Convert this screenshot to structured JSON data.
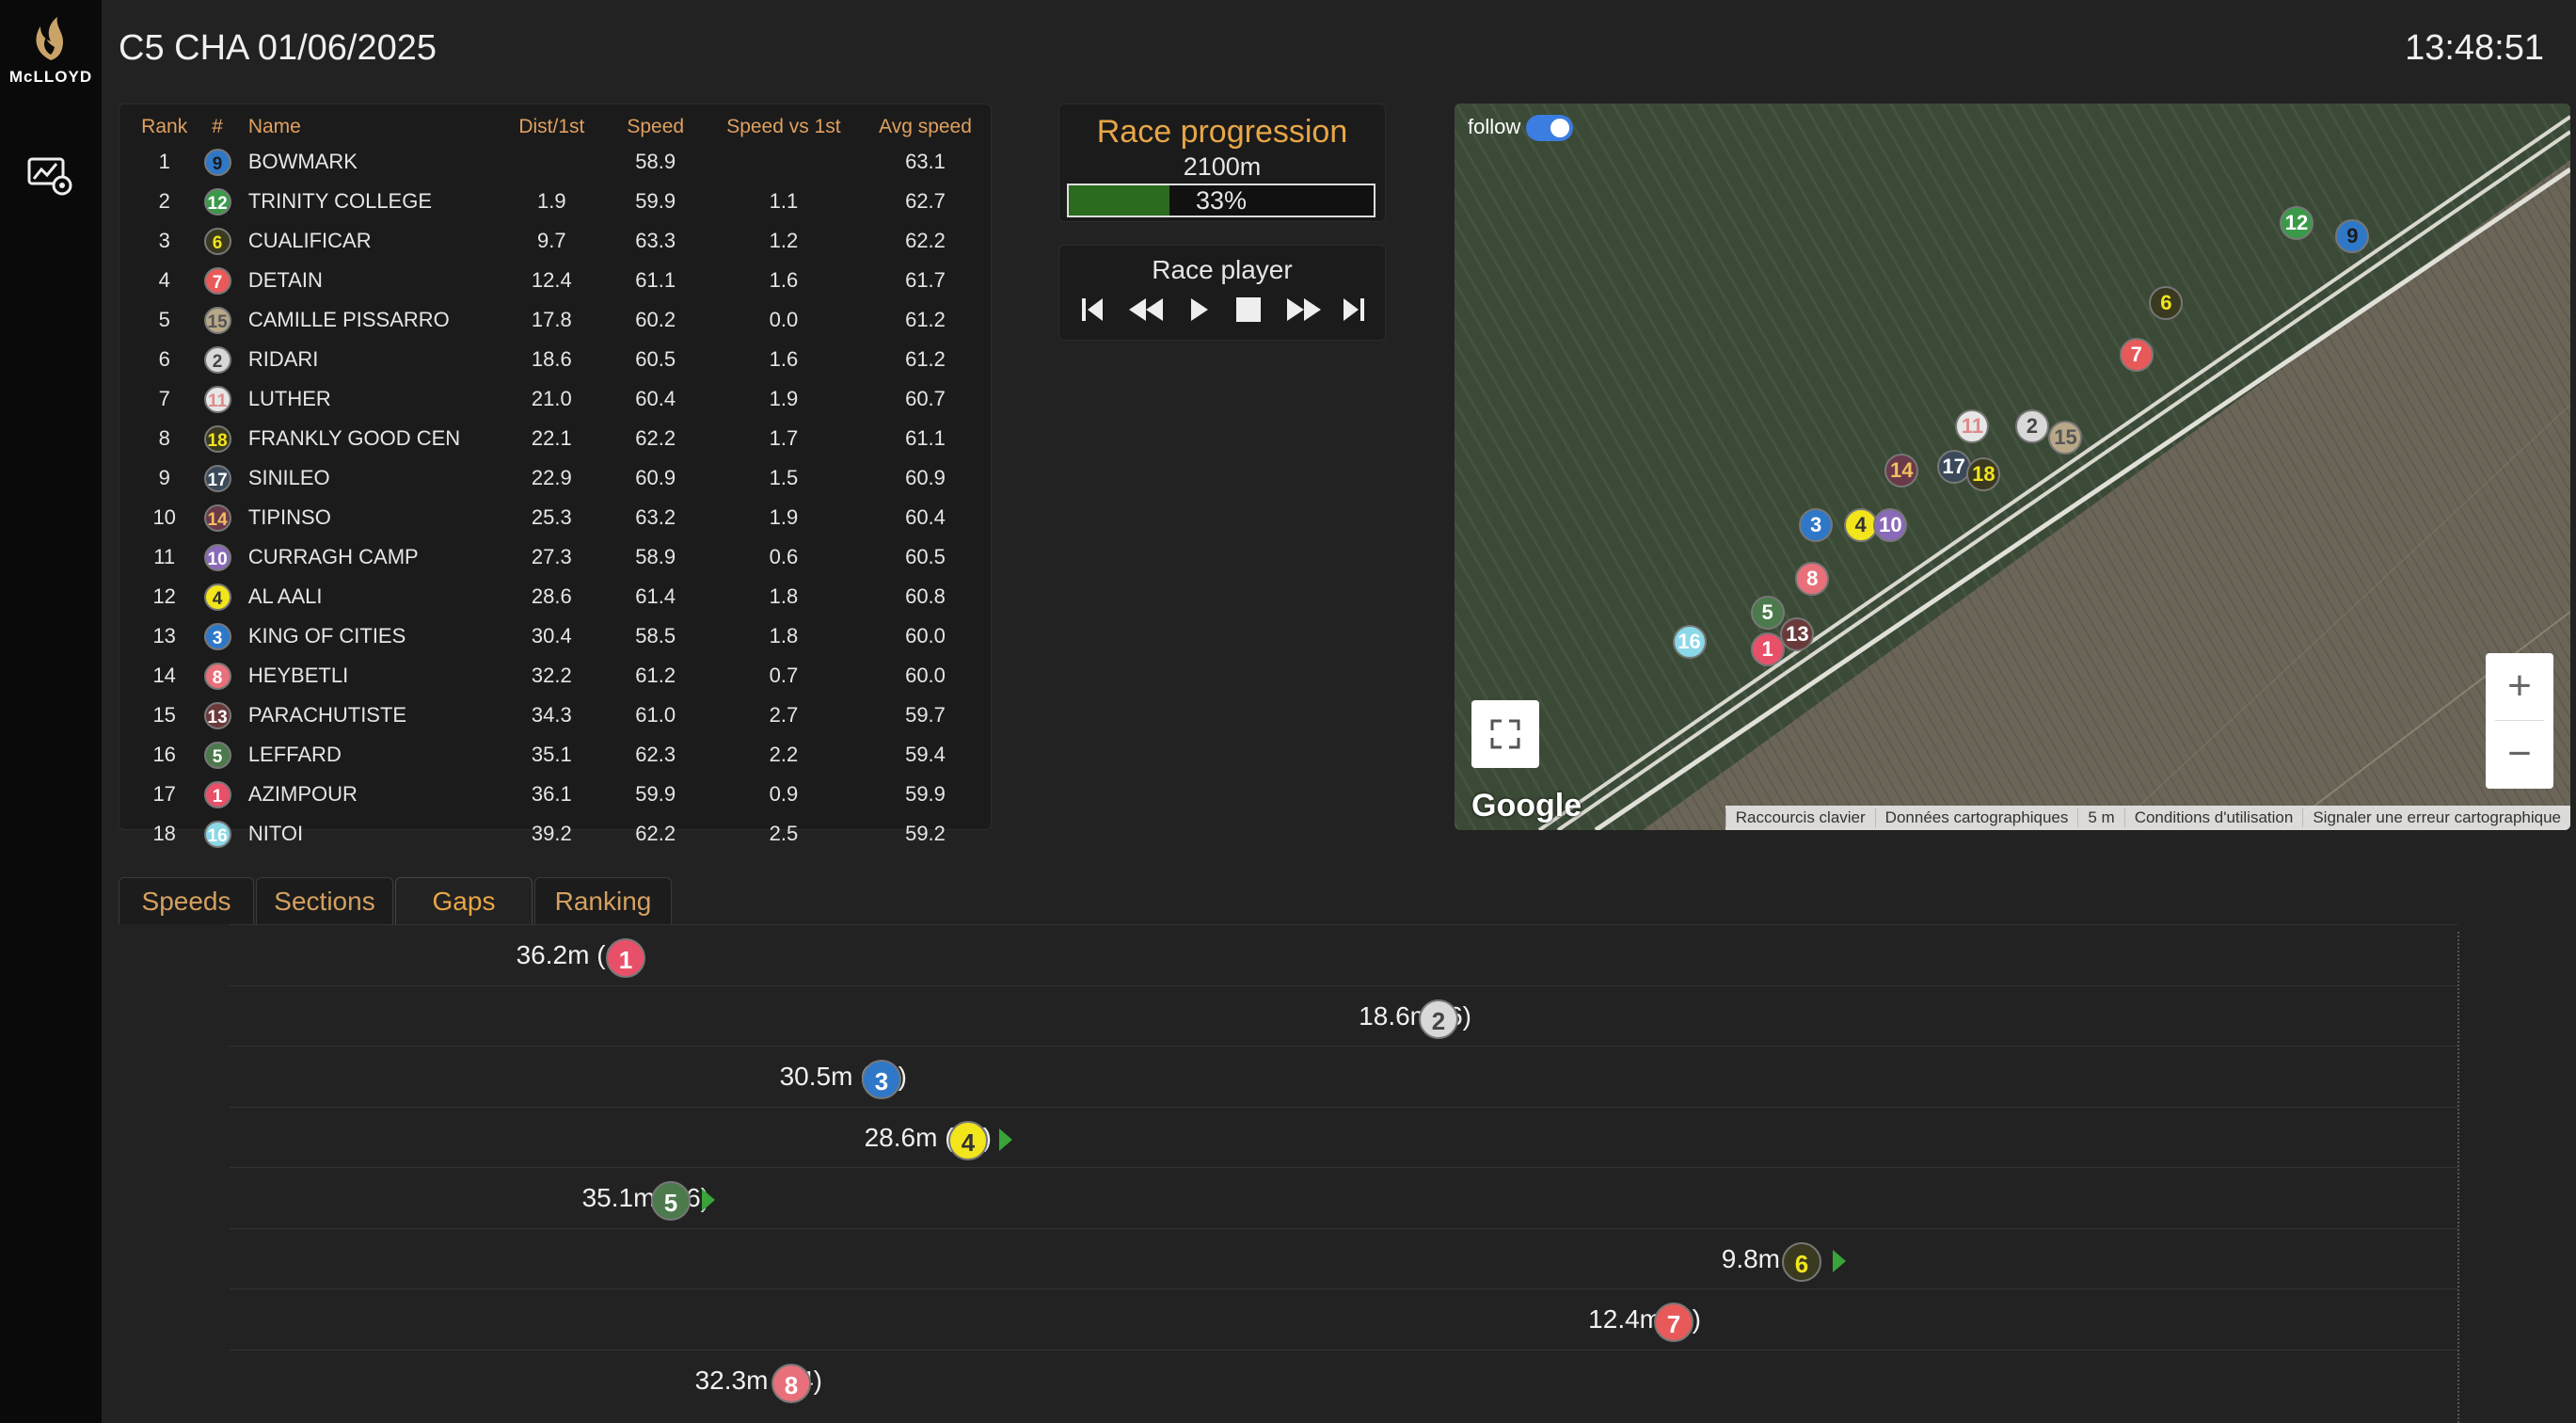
{
  "app": {
    "brand": "McLLOYD",
    "title": "C5 CHA 01/06/2025",
    "clock": "13:48:51"
  },
  "table": {
    "headers": [
      "Rank",
      "#",
      "Name",
      "Dist/1st",
      "Speed",
      "Speed vs 1st",
      "Avg speed"
    ],
    "rows": [
      {
        "rank": "1",
        "num": "9",
        "name": "BOWMARK",
        "dist": "",
        "speed": "58.9",
        "svf": "",
        "avg": "63.1"
      },
      {
        "rank": "2",
        "num": "12",
        "name": "TRINITY COLLEGE",
        "dist": "1.9",
        "speed": "59.9",
        "svf": "1.1",
        "avg": "62.7"
      },
      {
        "rank": "3",
        "num": "6",
        "name": "CUALIFICAR",
        "dist": "9.7",
        "speed": "63.3",
        "svf": "1.2",
        "avg": "62.2"
      },
      {
        "rank": "4",
        "num": "7",
        "name": "DETAIN",
        "dist": "12.4",
        "speed": "61.1",
        "svf": "1.6",
        "avg": "61.7"
      },
      {
        "rank": "5",
        "num": "15",
        "name": "CAMILLE PISSARRO",
        "dist": "17.8",
        "speed": "60.2",
        "svf": "0.0",
        "avg": "61.2"
      },
      {
        "rank": "6",
        "num": "2",
        "name": "RIDARI",
        "dist": "18.6",
        "speed": "60.5",
        "svf": "1.6",
        "avg": "61.2"
      },
      {
        "rank": "7",
        "num": "11",
        "name": "LUTHER",
        "dist": "21.0",
        "speed": "60.4",
        "svf": "1.9",
        "avg": "60.7"
      },
      {
        "rank": "8",
        "num": "18",
        "name": "FRANKLY GOOD CEN",
        "dist": "22.1",
        "speed": "62.2",
        "svf": "1.7",
        "avg": "61.1"
      },
      {
        "rank": "9",
        "num": "17",
        "name": "SINILEO",
        "dist": "22.9",
        "speed": "60.9",
        "svf": "1.5",
        "avg": "60.9"
      },
      {
        "rank": "10",
        "num": "14",
        "name": "TIPINSO",
        "dist": "25.3",
        "speed": "63.2",
        "svf": "1.9",
        "avg": "60.4"
      },
      {
        "rank": "11",
        "num": "10",
        "name": "CURRAGH CAMP",
        "dist": "27.3",
        "speed": "58.9",
        "svf": "0.6",
        "avg": "60.5"
      },
      {
        "rank": "12",
        "num": "4",
        "name": "AL AALI",
        "dist": "28.6",
        "speed": "61.4",
        "svf": "1.8",
        "avg": "60.8"
      },
      {
        "rank": "13",
        "num": "3",
        "name": "KING OF CITIES",
        "dist": "30.4",
        "speed": "58.5",
        "svf": "1.8",
        "avg": "60.0"
      },
      {
        "rank": "14",
        "num": "8",
        "name": "HEYBETLI",
        "dist": "32.2",
        "speed": "61.2",
        "svf": "0.7",
        "avg": "60.0"
      },
      {
        "rank": "15",
        "num": "13",
        "name": "PARACHUTISTE",
        "dist": "34.3",
        "speed": "61.0",
        "svf": "2.7",
        "avg": "59.7"
      },
      {
        "rank": "16",
        "num": "5",
        "name": "LEFFARD",
        "dist": "35.1",
        "speed": "62.3",
        "svf": "2.2",
        "avg": "59.4"
      },
      {
        "rank": "17",
        "num": "1",
        "name": "AZIMPOUR",
        "dist": "36.1",
        "speed": "59.9",
        "svf": "0.9",
        "avg": "59.9"
      },
      {
        "rank": "18",
        "num": "16",
        "name": "NITOI",
        "dist": "39.2",
        "speed": "62.2",
        "svf": "2.5",
        "avg": "59.2"
      }
    ]
  },
  "progress": {
    "title": "Race progression",
    "distance": "2100m",
    "percent_label": "33%",
    "percent": 0.33
  },
  "player": {
    "title": "Race player",
    "controls": [
      "skip-start",
      "rewind",
      "play",
      "stop",
      "fast-forward",
      "skip-end"
    ]
  },
  "map": {
    "follow_label": "follow",
    "follow_on": true,
    "google_label": "Google",
    "attribution": [
      "Raccourcis clavier",
      "Données cartographiques",
      "5 m",
      "Conditions d'utilisation",
      "Signaler une erreur cartographique"
    ],
    "zoom_in": "+",
    "zoom_out": "−"
  },
  "tabs": [
    "Speeds",
    "Sections",
    "Gaps",
    "Ranking"
  ],
  "active_tab": "Gaps",
  "gaps": [
    {
      "num": "1",
      "label": "36.2m (17)",
      "arrow": false
    },
    {
      "num": "2",
      "label": "18.6m (6)",
      "arrow": false
    },
    {
      "num": "3",
      "label": "30.5m (13)",
      "arrow": false
    },
    {
      "num": "4",
      "label": "28.6m (12)",
      "arrow": true
    },
    {
      "num": "5",
      "label": "35.1m (16)",
      "arrow": true
    },
    {
      "num": "6",
      "label": "9.8m (3)",
      "arrow": true
    },
    {
      "num": "7",
      "label": "12.4m (4)",
      "arrow": false
    },
    {
      "num": "8",
      "label": "32.3m (14)",
      "arrow": false
    }
  ],
  "colors": {
    "accent": "#e8a646",
    "badges": {
      "1": {
        "bg": "#e8506a",
        "fg": "#ffffff"
      },
      "2": {
        "bg": "#d8d8d8",
        "fg": "#444444"
      },
      "3": {
        "bg": "#2f78c8",
        "fg": "#ffffff"
      },
      "4": {
        "bg": "#f2e51c",
        "fg": "#333333"
      },
      "5": {
        "bg": "#4c7a4c",
        "fg": "#ffffff"
      },
      "6": {
        "bg": "#3a3a20",
        "fg": "#f2e51c"
      },
      "7": {
        "bg": "#e85a5a",
        "fg": "#ffffff"
      },
      "8": {
        "bg": "#e8707a",
        "fg": "#ffffff"
      },
      "9": {
        "bg": "#2f78c8",
        "fg": "#1a1a1a"
      },
      "10": {
        "bg": "#8a6ab8",
        "fg": "#ffffff"
      },
      "11": {
        "bg": "#e6e6e6",
        "fg": "#e08a8a"
      },
      "12": {
        "bg": "#3a9a4a",
        "fg": "#ffffff"
      },
      "13": {
        "bg": "#6a3a3a",
        "fg": "#ffffff"
      },
      "14": {
        "bg": "#6a3a4a",
        "fg": "#f0c060"
      },
      "15": {
        "bg": "#b8a888",
        "fg": "#555555"
      },
      "16": {
        "bg": "#8ad8e8",
        "fg": "#ffffff"
      },
      "17": {
        "bg": "#3a4a5a",
        "fg": "#ffffff"
      },
      "18": {
        "bg": "#3a3a20",
        "fg": "#f2e51c"
      }
    }
  }
}
